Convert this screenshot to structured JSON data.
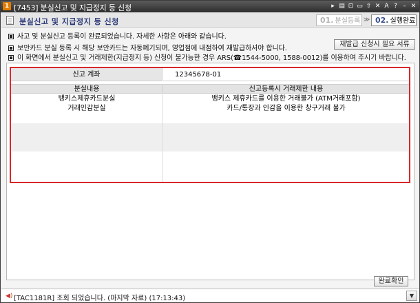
{
  "window": {
    "badge": "1",
    "title": "[7453] 분실신고 및 지급정지 등 신청",
    "controls": [
      "▸",
      "▤",
      "⊡",
      "▭",
      "⇧",
      "✕",
      "A",
      "?",
      "–",
      "✕"
    ]
  },
  "header": {
    "title": "분실신고 및 지급정지 등 신청",
    "steps": [
      {
        "num": "01.",
        "label": "분실등록"
      },
      {
        "num": "02.",
        "label": "실행완료"
      }
    ],
    "step_arrow": "≫"
  },
  "info": [
    "사고 및 분실신고 등록이 완료되었습니다. 자세한 사항은 아래와 같습니다.",
    "보안카드 분실 등록 시 해당 보안카드는 자동폐기되며, 영업점에 내점하여 재발급하셔야 합니다.",
    "이 화면에서 분실신고 및 거래제한(지급정지 등) 신청이 불가능한 경우 ARS(☎1544-5000, 1588-0012)를 이용하여 주시기 바랍니다."
  ],
  "reissue_button": "재발급 신청시 필요 서류",
  "account": {
    "label": "신고 계좌",
    "value": "12345678-01"
  },
  "table": {
    "headers": [
      "분실내용",
      "신고등록시 거래제한 내용"
    ],
    "rows": [
      [
        "뱅키스제휴카드분실",
        "뱅키스 제휴카드를 이용한 거래불가 (ATM거래포함)"
      ],
      [
        "거래인감분실",
        "카드/통장과 인감을 이용한 창구거래 불가"
      ]
    ]
  },
  "confirm_button": "완료확인",
  "status": {
    "icon": "speaker-icon",
    "text": "[TAC1181R] 조회 되었습니다. (마지막 자료) (17:13:43)",
    "dropdown": "▼"
  }
}
